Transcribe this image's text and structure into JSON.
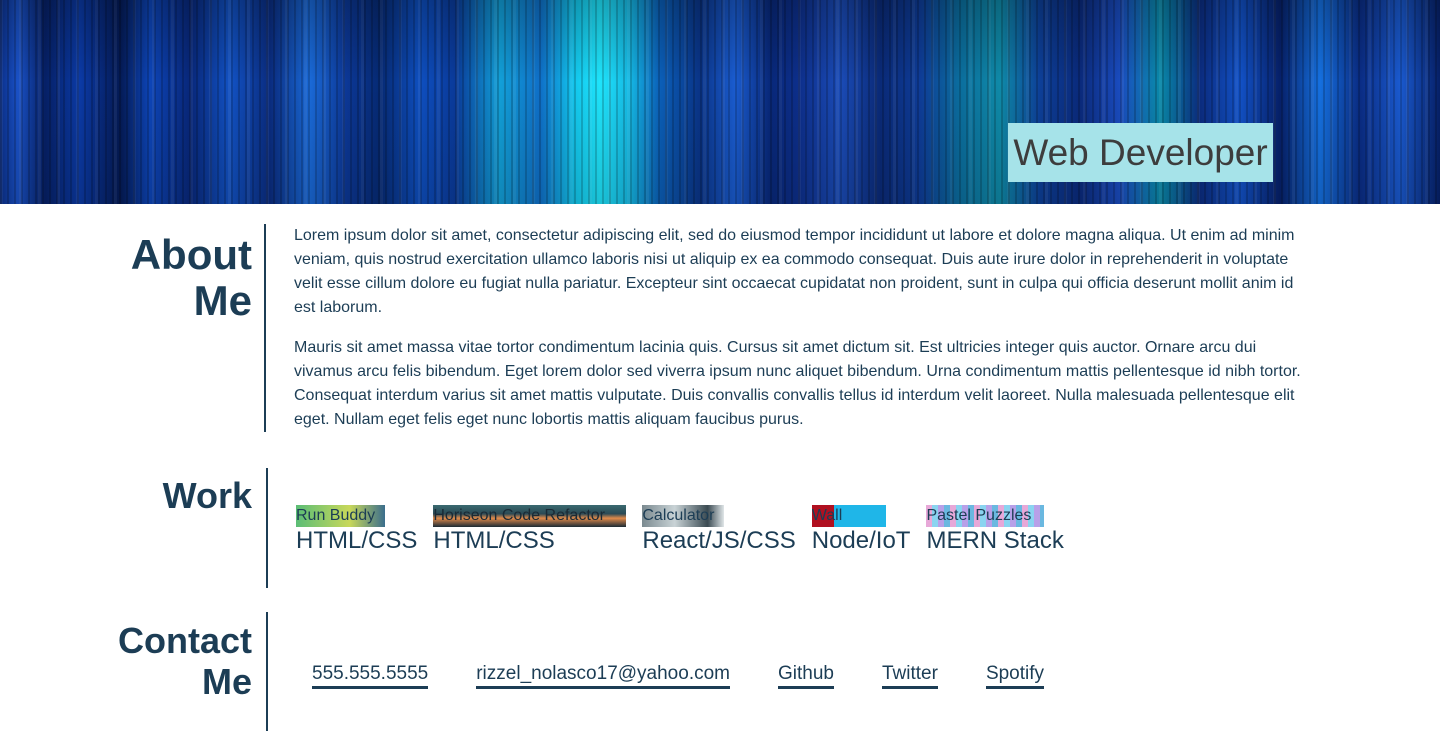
{
  "header": {
    "title": "Web Developer"
  },
  "about": {
    "heading_line1": "About",
    "heading_line2": "Me",
    "paragraphs": [
      "Lorem ipsum dolor sit amet, consectetur adipiscing elit, sed do eiusmod tempor incididunt ut labore et dolore magna aliqua. Ut enim ad minim veniam, quis nostrud exercitation ullamco laboris nisi ut aliquip ex ea commodo consequat. Duis aute irure dolor in reprehenderit in voluptate velit esse cillum dolore eu fugiat nulla pariatur. Excepteur sint occaecat cupidatat non proident, sunt in culpa qui officia deserunt mollit anim id est laborum.",
      "Mauris sit amet massa vitae tortor condimentum lacinia quis. Cursus sit amet dictum sit. Est ultricies integer quis auctor. Ornare arcu dui vivamus arcu felis bibendum. Eget lorem dolor sed viverra ipsum nunc aliquet bibendum. Urna condimentum mattis pellentesque id nibh tortor. Consequat interdum varius sit amet mattis vulputate. Duis convallis convallis tellus id interdum velit laoreet. Nulla malesuada pellentesque elit eget. Nullam eget felis eget nunc lobortis mattis aliquam faucibus purus."
    ]
  },
  "work": {
    "heading": "Work",
    "items": [
      {
        "title": "Run Buddy",
        "tech": "HTML/CSS"
      },
      {
        "title": "Horiseon Code Refactor",
        "tech": "HTML/CSS"
      },
      {
        "title": "Calculator",
        "tech": "React/JS/CSS"
      },
      {
        "title": "Wall",
        "tech": "Node/IoT"
      },
      {
        "title": "Pastel Puzzles",
        "tech": "MERN Stack"
      }
    ]
  },
  "contact": {
    "heading_line1": "Contact",
    "heading_line2": "Me",
    "links": [
      {
        "label": "555.555.5555"
      },
      {
        "label": "rizzel_nolasco17@yahoo.com"
      },
      {
        "label": "Github"
      },
      {
        "label": "Twitter"
      },
      {
        "label": "Spotify"
      }
    ]
  },
  "colors": {
    "primary_text": "#1c3d55",
    "title_badge": "#a6e3e9",
    "title_text": "#3d3d3d"
  }
}
